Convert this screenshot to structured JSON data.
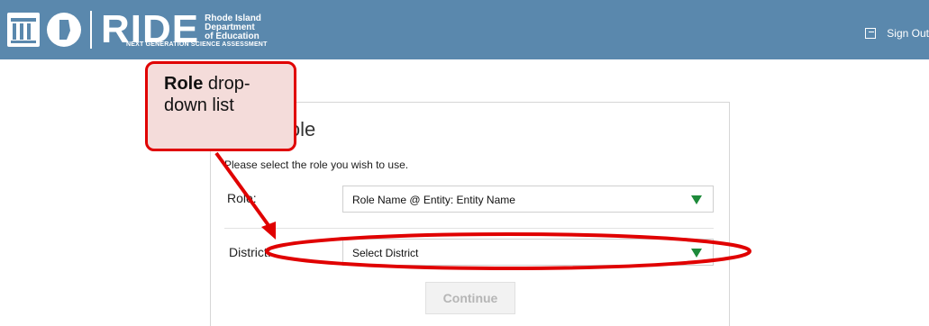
{
  "header": {
    "brand_main": "RIDE",
    "brand_sub_line1": "Rhode Island",
    "brand_sub_line2": "Department",
    "brand_sub_line3": "of Education",
    "program": "NEXT GENERATION SCIENCE ASSESSMENT",
    "signout_label": "Sign Out"
  },
  "card": {
    "title": "Role",
    "instructions": "Please select the role you wish to use.",
    "role_label": "Role:",
    "role_value": "Role Name @ Entity: Entity Name",
    "district_label": "District:",
    "district_value": "Select District",
    "continue_label": "Continue"
  },
  "callout": {
    "bold": "Role",
    "text": " drop-down list"
  },
  "colors": {
    "header_bg": "#5a88ad",
    "caret": "#1d8a3a",
    "annotation_red": "#e00000",
    "callout_bg": "#f4dcda"
  }
}
